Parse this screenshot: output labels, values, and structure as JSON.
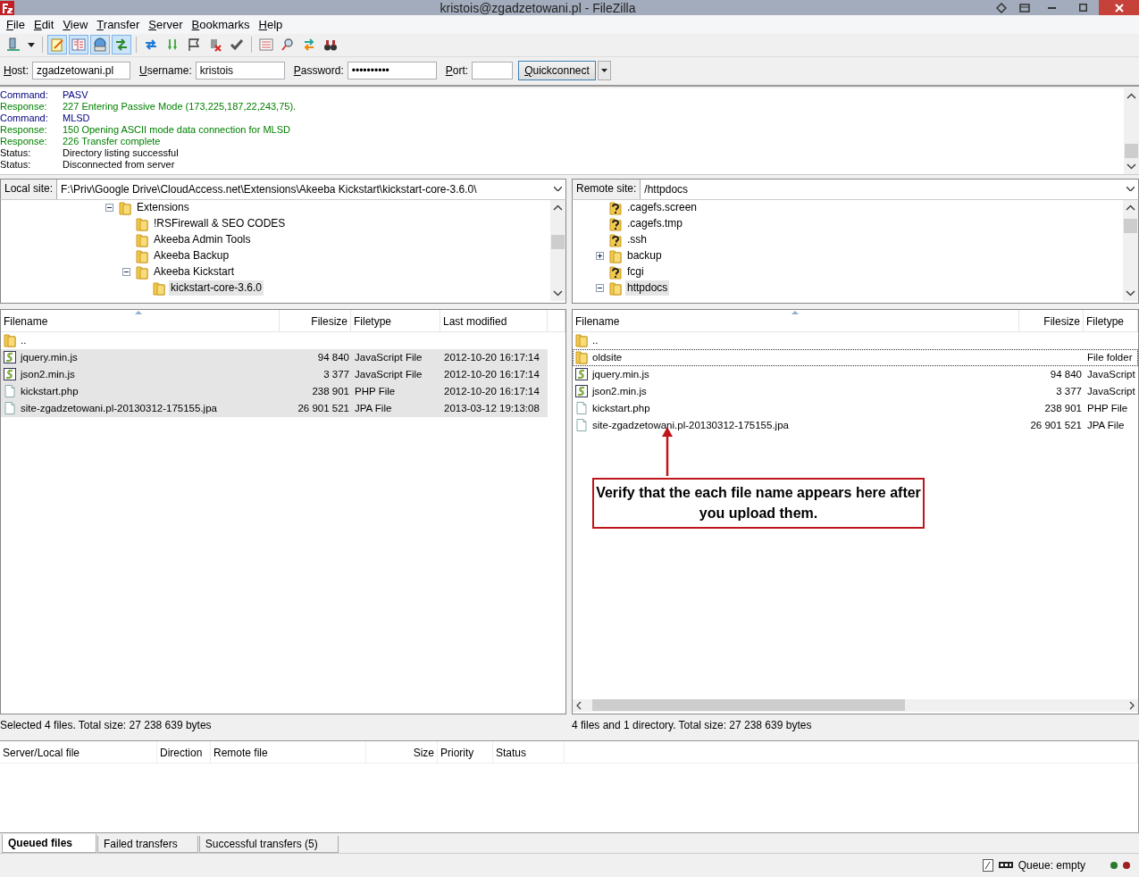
{
  "window": {
    "title": "kristois@zgadzetowani.pl - FileZilla"
  },
  "menu": [
    "File",
    "Edit",
    "View",
    "Transfer",
    "Server",
    "Bookmarks",
    "Help"
  ],
  "toolbar": {
    "toggles": [
      {
        "pressed": true
      },
      {
        "pressed": true
      },
      {
        "pressed": true
      },
      {
        "pressed": true
      }
    ]
  },
  "quickconnect": {
    "host_label": "Host:",
    "host": "zgadzetowani.pl",
    "username_label": "Username:",
    "username": "kristois",
    "password_label": "Password:",
    "password": "••••••••••",
    "port_label": "Port:",
    "button": "Quickconnect"
  },
  "log": [
    {
      "kind": "command",
      "label": "Command:",
      "text": "PASV"
    },
    {
      "kind": "response",
      "label": "Response:",
      "text": "227 Entering Passive Mode (173,225,187,22,243,75)."
    },
    {
      "kind": "command",
      "label": "Command:",
      "text": "MLSD"
    },
    {
      "kind": "response",
      "label": "Response:",
      "text": "150 Opening ASCII mode data connection for MLSD"
    },
    {
      "kind": "response",
      "label": "Response:",
      "text": "226 Transfer complete"
    },
    {
      "kind": "status",
      "label": "Status:",
      "text": "Directory listing successful"
    },
    {
      "kind": "status",
      "label": "Status:",
      "text": "Disconnected from server"
    }
  ],
  "local_site": {
    "label": "Local site:",
    "path": "F:\\Priv\\Google Drive\\CloudAccess.net\\Extensions\\Akeeba Kickstart\\kickstart-core-3.6.0\\",
    "tree": [
      {
        "label": "Extensions",
        "kind": "folder",
        "expanded": true,
        "selected": false,
        "children": [
          {
            "label": "!RSFirewall & SEO CODES",
            "kind": "folder",
            "selected": false
          },
          {
            "label": "Akeeba Admin Tools",
            "kind": "folder",
            "selected": false
          },
          {
            "label": "Akeeba Backup",
            "kind": "folder",
            "selected": false
          },
          {
            "label": "Akeeba Kickstart",
            "kind": "folder",
            "expanded": true,
            "selected": false,
            "children": [
              {
                "label": "kickstart-core-3.6.0",
                "kind": "folder",
                "selected": true
              }
            ]
          }
        ]
      }
    ],
    "columns": [
      "Filename",
      "Filesize",
      "Filetype",
      "Last modified"
    ],
    "files": [
      {
        "name": "..",
        "kind": "folder",
        "selected": false
      },
      {
        "name": "jquery.min.js",
        "size": "94 840",
        "type": "JavaScript File",
        "modified": "2012-10-20 16:17:14",
        "kind": "script",
        "selected": true
      },
      {
        "name": "json2.min.js",
        "size": "3 377",
        "type": "JavaScript File",
        "modified": "2012-10-20 16:17:14",
        "kind": "script",
        "selected": true
      },
      {
        "name": "kickstart.php",
        "size": "238 901",
        "type": "PHP File",
        "modified": "2012-10-20 16:17:14",
        "kind": "document",
        "selected": true
      },
      {
        "name": "site-zgadzetowani.pl-20130312-175155.jpa",
        "size": "26 901 521",
        "type": "JPA File",
        "modified": "2013-03-12 19:13:08",
        "kind": "document",
        "selected": true
      }
    ],
    "status": "Selected 4 files. Total size: 27 238 639 bytes"
  },
  "remote_site": {
    "label": "Remote site:",
    "path": "/httpdocs",
    "tree": [
      {
        "label": ".cagefs.screen",
        "kind": "unknown",
        "selected": false
      },
      {
        "label": ".cagefs.tmp",
        "kind": "unknown",
        "selected": false
      },
      {
        "label": ".ssh",
        "kind": "unknown",
        "selected": false
      },
      {
        "label": "backup",
        "kind": "folder",
        "expanded": false,
        "selected": false
      },
      {
        "label": "fcgi",
        "kind": "unknown",
        "selected": false
      },
      {
        "label": "httpdocs",
        "kind": "folder",
        "expanded": true,
        "selected": true
      }
    ],
    "columns": [
      "Filename",
      "Filesize",
      "Filetype"
    ],
    "files": [
      {
        "name": "..",
        "kind": "folder",
        "focused": false
      },
      {
        "name": "oldsite",
        "type": "File folder",
        "kind": "folder",
        "focused": true
      },
      {
        "name": "jquery.min.js",
        "size": "94 840",
        "type": "JavaScript",
        "kind": "script",
        "focused": false
      },
      {
        "name": "json2.min.js",
        "size": "3 377",
        "type": "JavaScript",
        "kind": "script",
        "focused": false
      },
      {
        "name": "kickstart.php",
        "size": "238 901",
        "type": "PHP File",
        "kind": "document",
        "focused": false
      },
      {
        "name": "site-zgadzetowani.pl-20130312-175155.jpa",
        "size": "26 901 521",
        "type": "JPA File",
        "kind": "document",
        "focused": false
      }
    ],
    "annotation": "Verify that the each file name appears here after you upload them.",
    "status": "4 files and 1 directory. Total size: 27 238 639 bytes"
  },
  "queue": {
    "columns": [
      "Server/Local file",
      "Direction",
      "Remote file",
      "Size",
      "Priority",
      "Status"
    ],
    "tabs": [
      {
        "label": "Queued files",
        "selected": true
      },
      {
        "label": "Failed transfers",
        "selected": false
      },
      {
        "label": "Successful transfers (5)",
        "selected": false
      }
    ]
  },
  "status_bar": {
    "queue": "Queue: empty"
  }
}
